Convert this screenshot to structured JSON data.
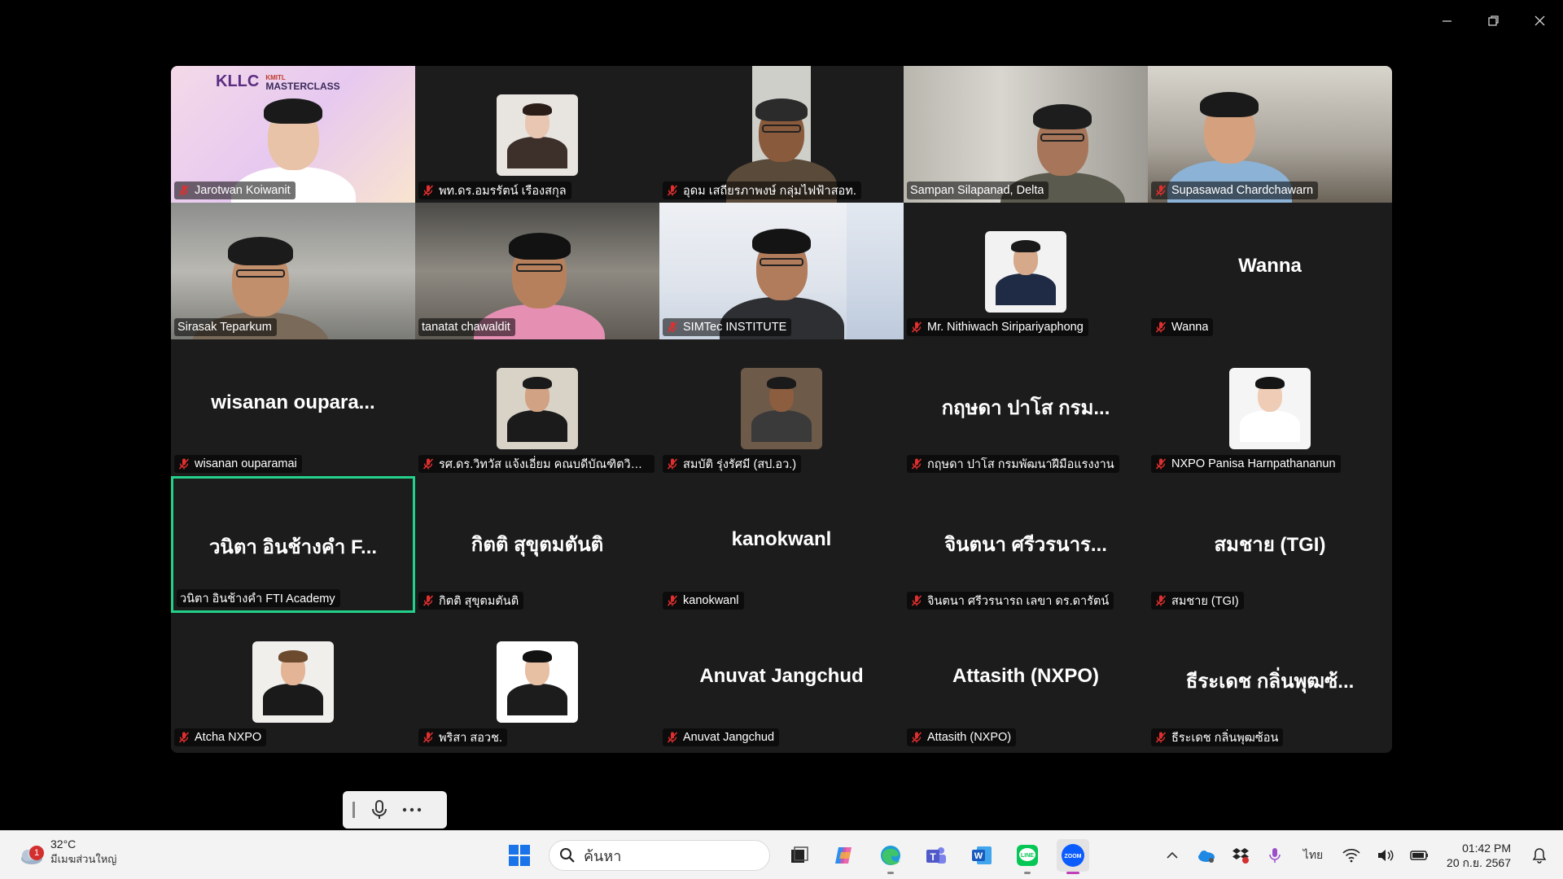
{
  "window": {
    "controls": [
      {
        "name": "minimize-icon"
      },
      {
        "name": "restore-icon"
      },
      {
        "name": "close-icon"
      }
    ]
  },
  "gallery": {
    "active_speaker_color": "#23d18b",
    "muted_icon_color": "#e02f2f",
    "participants": [
      {
        "name": "Jarotwan Koiwanit",
        "display": "",
        "muted": true,
        "kind": "video"
      },
      {
        "name": "พท.ดร.อมรรัตน์ เรืองสกุล",
        "display": "",
        "muted": true,
        "kind": "avatar"
      },
      {
        "name": "อุดม เสถียรภาพงษ์ กลุ่มไฟฟ้าสอท.",
        "display": "",
        "muted": true,
        "kind": "video"
      },
      {
        "name": "Sampan Silapanad, Delta",
        "display": "",
        "muted": false,
        "kind": "video"
      },
      {
        "name": "Supasawad Chardchawarn",
        "display": "",
        "muted": true,
        "kind": "video"
      },
      {
        "name": "Sirasak Teparkum",
        "display": "",
        "muted": false,
        "kind": "video"
      },
      {
        "name": "tanatat chawaldit",
        "display": "",
        "muted": false,
        "kind": "video"
      },
      {
        "name": "SIMTec INSTITUTE",
        "display": "",
        "muted": true,
        "kind": "video"
      },
      {
        "name": "Mr. Nithiwach Siripariyaphong",
        "display": "",
        "muted": true,
        "kind": "avatar"
      },
      {
        "name": "Wanna",
        "display": "Wanna",
        "muted": true,
        "kind": "name"
      },
      {
        "name": "wisanan ouparamai",
        "display": "wisanan  oupara...",
        "muted": true,
        "kind": "name"
      },
      {
        "name": "รศ.ดร.วิทวัส แจ้งเอี่ยม คณบดีบัณฑิตวิทยาลั...",
        "display": "",
        "muted": true,
        "kind": "avatar"
      },
      {
        "name": "สมบัติ รุ่งรัศมี (สป.อว.)",
        "display": "",
        "muted": true,
        "kind": "avatar"
      },
      {
        "name": "กฤษดา ปาโส กรมพัฒนาฝีมือแรงงาน",
        "display": "กฤษดา ปาโส กรม...",
        "muted": true,
        "kind": "name"
      },
      {
        "name": "NXPO Panisa Harnpathananun",
        "display": "",
        "muted": true,
        "kind": "avatar"
      },
      {
        "name": "วนิตา อินช้างคำ FTI Academy",
        "display": "วนิตา อินช้างคำ F...",
        "muted": false,
        "kind": "name",
        "speaking": true
      },
      {
        "name": "กิตติ สุขุตมตันติ",
        "display": "กิตติ สุขุตมตันติ",
        "muted": true,
        "kind": "name"
      },
      {
        "name": "kanokwanl",
        "display": "kanokwanl",
        "muted": true,
        "kind": "name"
      },
      {
        "name": "จินตนา ศรีวรนารถ เลขา ดร.ดารัตน์",
        "display": "จินตนา ศรีวรนาร...",
        "muted": true,
        "kind": "name"
      },
      {
        "name": "สมชาย (TGI)",
        "display": "สมชาย (TGI)",
        "muted": true,
        "kind": "name"
      },
      {
        "name": "Atcha NXPO",
        "display": "",
        "muted": true,
        "kind": "avatar"
      },
      {
        "name": "พริสา สอวช.",
        "display": "",
        "muted": true,
        "kind": "avatar"
      },
      {
        "name": "Anuvat Jangchud",
        "display": "Anuvat Jangchud",
        "muted": true,
        "kind": "name"
      },
      {
        "name": "Attasith (NXPO)",
        "display": "Attasith (NXPO)",
        "muted": true,
        "kind": "name"
      },
      {
        "name": "ธีระเดช กลิ่นพุฒซ้อน",
        "display": "ธีระเดช กลิ่นพุฒซ้...",
        "muted": true,
        "kind": "name"
      }
    ],
    "tile1_logo": {
      "brand": "KLLC",
      "sub": "MASTERCLASS",
      "sub_prefix": "KMITL"
    }
  },
  "zoom_toolbar": {
    "items": [
      {
        "name": "microphone-icon"
      },
      {
        "name": "more-icon"
      }
    ]
  },
  "taskbar": {
    "weather": {
      "temp": "32°C",
      "condition": "มีเมฆส่วนใหญ่",
      "badge": "1"
    },
    "search_placeholder": "ค้นหา",
    "apps": [
      "start-icon",
      "task-view-icon",
      "copilot-icon",
      "edge-icon",
      "teams-icon",
      "word-icon",
      "line-icon",
      "zoom-icon"
    ],
    "tray": {
      "language": "ไทย",
      "time": "01:42 PM",
      "date": "20 ก.ย. 2567"
    }
  }
}
